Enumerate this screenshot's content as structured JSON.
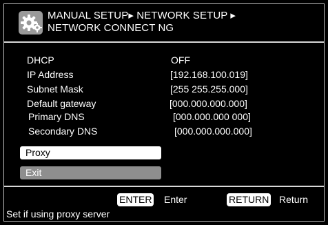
{
  "header": {
    "icon": "gear-icon",
    "title_line1": "MANUAL SETUP▸ NETWORK SETUP ▸",
    "title_line2": "NETWORK CONNECT NG"
  },
  "settings": [
    {
      "label": "DHCP",
      "value": "OFF"
    },
    {
      "label": "IP Address",
      "value": "[192.168.100.019]"
    },
    {
      "label": "Subnet Mask",
      "value": "[255 255.255.000]"
    },
    {
      "label": "Default gateway",
      "value": "[000.000.000.000]"
    },
    {
      "label": "Primary DNS",
      "value": "[000.000.000 000]"
    },
    {
      "label": "Secondary DNS",
      "value": "[000.000.000.000]"
    }
  ],
  "buttons": {
    "proxy": "Proxy",
    "exit": "Exit"
  },
  "footer": {
    "enter_key": "ENTER",
    "enter_label": "Enter",
    "return_key": "RETURN",
    "return_label": "Return",
    "status": "Set if using proxy server"
  },
  "colors": {
    "background": "#000000",
    "selected_button": "#ffffff",
    "unselected_button": "#8e8e8e",
    "icon_background": "#9a9a9a"
  }
}
